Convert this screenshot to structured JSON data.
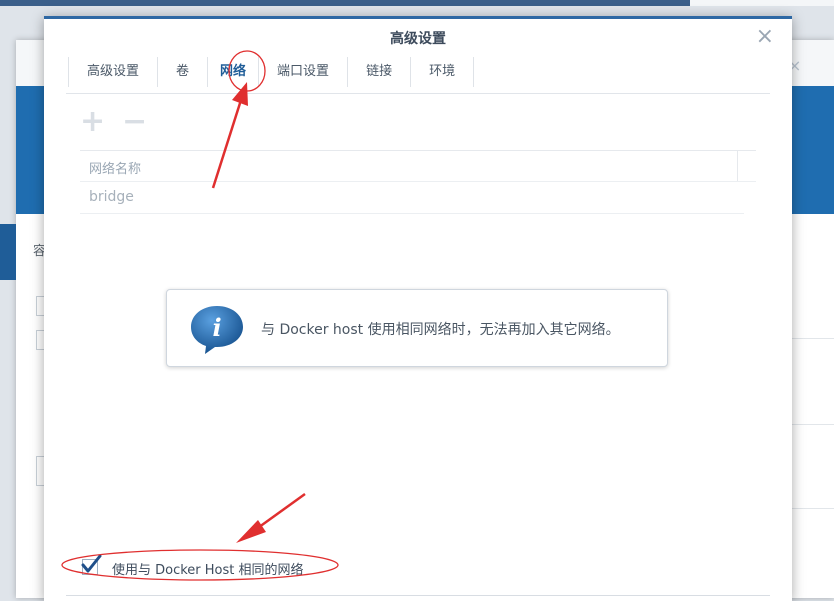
{
  "dialog": {
    "title": "高级设置",
    "close_symbol": "×",
    "tabs": [
      {
        "label": "高级设置",
        "active": false
      },
      {
        "label": "卷",
        "active": false
      },
      {
        "label": "网络",
        "active": true
      },
      {
        "label": "端口设置",
        "active": false
      },
      {
        "label": "链接",
        "active": false
      },
      {
        "label": "环境",
        "active": false
      }
    ],
    "toolbar": {
      "add_symbol": "+",
      "remove_symbol": "−"
    },
    "table": {
      "column_header": "网络名称",
      "rows": [
        {
          "name": "bridge"
        }
      ]
    },
    "info": {
      "icon": "info-icon",
      "icon_letter": "i",
      "message": "与 Docker host 使用相同网络时，无法再加入其它网络。"
    },
    "checkbox": {
      "label": "使用与 Docker Host 相同的网络",
      "checked": true
    }
  },
  "background": {
    "glyph_1": "容",
    "close_symbol": "×"
  },
  "colors": {
    "accent": "#2e68a4",
    "active_tab": "#1f5d98",
    "annotation": "#e02f2f",
    "info_icon": "#1e5e9e"
  }
}
